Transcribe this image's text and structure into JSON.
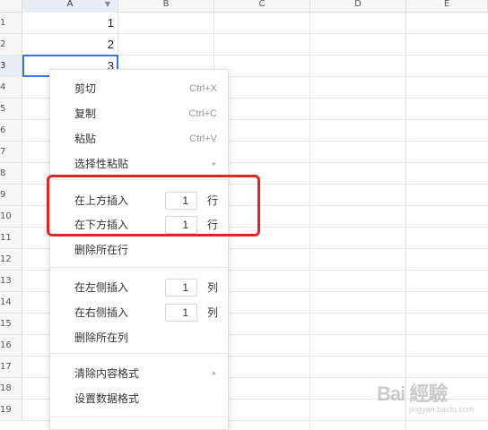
{
  "columns": [
    "A",
    "B",
    "C",
    "D",
    "E"
  ],
  "rows": [
    "1",
    "2",
    "3",
    "4",
    "5",
    "6",
    "7",
    "8",
    "9",
    "10",
    "11",
    "12",
    "13",
    "14",
    "15",
    "16",
    "17",
    "18",
    "19"
  ],
  "cells": [
    "1",
    "2",
    "3"
  ],
  "filter_arrow": "▼",
  "menu": {
    "cut": {
      "label": "剪切",
      "shortcut": "Ctrl+X"
    },
    "copy": {
      "label": "复制",
      "shortcut": "Ctrl+C"
    },
    "paste": {
      "label": "粘贴",
      "shortcut": "Ctrl+V"
    },
    "paste_special": {
      "label": "选择性粘贴",
      "arrow": "▸"
    },
    "insert_above": {
      "label": "在上方插入",
      "value": "1",
      "unit": "行"
    },
    "insert_below": {
      "label": "在下方插入",
      "value": "1",
      "unit": "行"
    },
    "delete_row": {
      "label": "删除所在行"
    },
    "insert_left": {
      "label": "在左侧插入",
      "value": "1",
      "unit": "列"
    },
    "insert_right": {
      "label": "在右侧插入",
      "value": "1",
      "unit": "列"
    },
    "delete_col": {
      "label": "删除所在列"
    },
    "clear_format": {
      "label": "清除内容格式",
      "arrow": "▸"
    },
    "data_format": {
      "label": "设置数据格式"
    }
  },
  "watermark": {
    "text": "Bai 經驗",
    "sub": "jingyan.baidu.com"
  },
  "colors": {
    "accent": "#3b73e1",
    "highlight": "#e0271f"
  }
}
